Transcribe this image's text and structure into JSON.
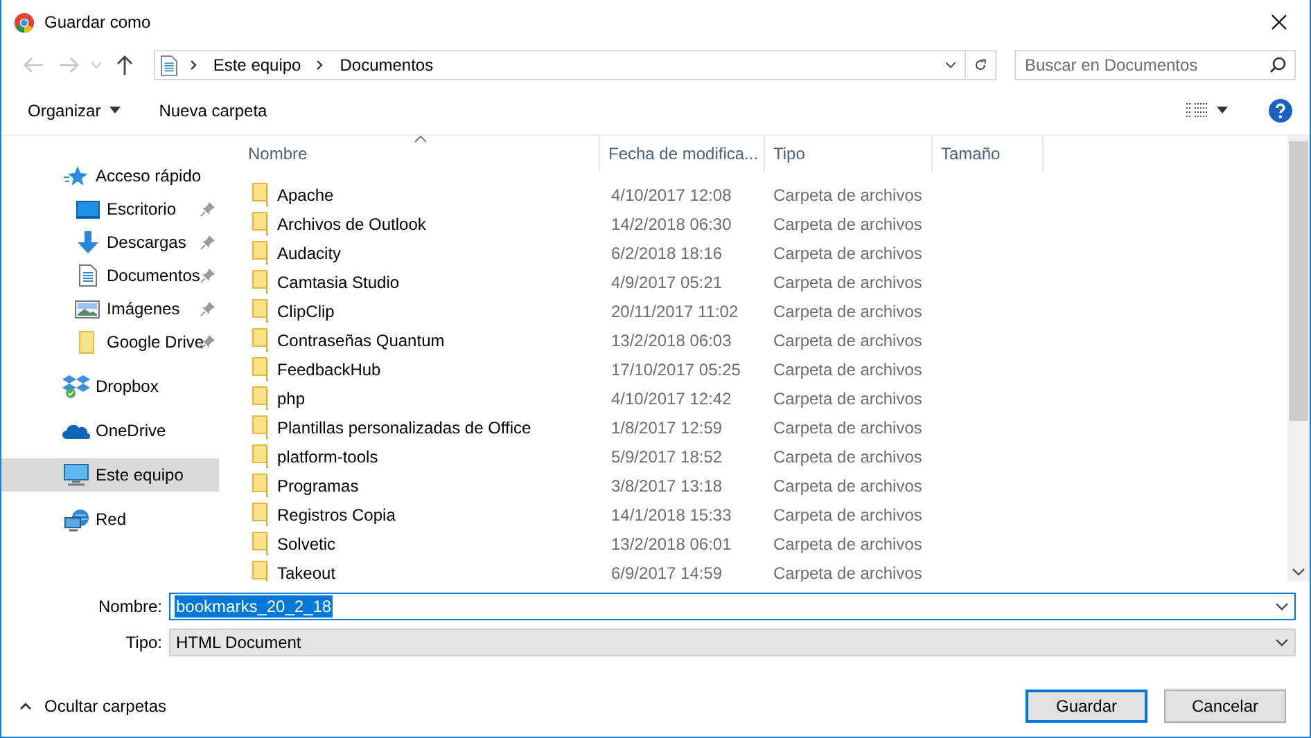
{
  "window": {
    "title": "Guardar como"
  },
  "navigation": {
    "path": [
      "Este equipo",
      "Documentos"
    ],
    "search": {
      "placeholder": "Buscar en Documentos"
    }
  },
  "toolbar": {
    "organize": "Organizar",
    "new_folder": "Nueva carpeta"
  },
  "sidebar": {
    "items": [
      {
        "label": "Acceso rápido",
        "selected": false,
        "children": [
          {
            "label": "Escritorio",
            "selected": false,
            "pinned": true
          },
          {
            "label": "Descargas",
            "selected": false,
            "pinned": true
          },
          {
            "label": "Documentos",
            "selected": false,
            "pinned": true
          },
          {
            "label": "Imágenes",
            "selected": false,
            "pinned": true
          },
          {
            "label": "Google Drive",
            "selected": false,
            "pinned": true
          }
        ]
      },
      {
        "label": "Dropbox",
        "selected": false
      },
      {
        "label": "OneDrive",
        "selected": false
      },
      {
        "label": "Este equipo",
        "selected": true
      },
      {
        "label": "Red",
        "selected": false
      }
    ]
  },
  "file_list": {
    "columns": [
      {
        "label": "Nombre",
        "sorted": true
      },
      {
        "label": "Fecha de modifica...",
        "sorted": false
      },
      {
        "label": "Tipo",
        "sorted": false
      },
      {
        "label": "Tamaño",
        "sorted": false
      }
    ],
    "rows": [
      {
        "name": "Apache",
        "date": "4/10/2017 12:08",
        "type": "Carpeta de archivos"
      },
      {
        "name": "Archivos de Outlook",
        "date": "14/2/2018 06:30",
        "type": "Carpeta de archivos"
      },
      {
        "name": "Audacity",
        "date": "6/2/2018 18:16",
        "type": "Carpeta de archivos"
      },
      {
        "name": "Camtasia Studio",
        "date": "4/9/2017 05:21",
        "type": "Carpeta de archivos"
      },
      {
        "name": "ClipClip",
        "date": "20/11/2017 11:02",
        "type": "Carpeta de archivos"
      },
      {
        "name": "Contraseñas Quantum",
        "date": "13/2/2018 06:03",
        "type": "Carpeta de archivos"
      },
      {
        "name": "FeedbackHub",
        "date": "17/10/2017 05:25",
        "type": "Carpeta de archivos"
      },
      {
        "name": "php",
        "date": "4/10/2017 12:42",
        "type": "Carpeta de archivos"
      },
      {
        "name": "Plantillas personalizadas de Office",
        "date": "1/8/2017 12:59",
        "type": "Carpeta de archivos"
      },
      {
        "name": "platform-tools",
        "date": "5/9/2017 18:52",
        "type": "Carpeta de archivos"
      },
      {
        "name": "Programas",
        "date": "3/8/2017 13:18",
        "type": "Carpeta de archivos"
      },
      {
        "name": "Registros Copia",
        "date": "14/1/2018 15:33",
        "type": "Carpeta de archivos"
      },
      {
        "name": "Solvetic",
        "date": "13/2/2018 06:01",
        "type": "Carpeta de archivos"
      },
      {
        "name": "Takeout",
        "date": "6/9/2017 14:59",
        "type": "Carpeta de archivos"
      }
    ]
  },
  "form": {
    "file_name": {
      "label": "Nombre:",
      "value": "bookmarks_20_2_18",
      "selected": true
    },
    "file_type": {
      "label": "Tipo:",
      "value": "HTML Document"
    }
  },
  "footer": {
    "hide_folders": "Ocultar carpetas",
    "buttons": [
      {
        "label": "Guardar",
        "default": true
      },
      {
        "label": "Cancelar",
        "default": false
      }
    ]
  }
}
